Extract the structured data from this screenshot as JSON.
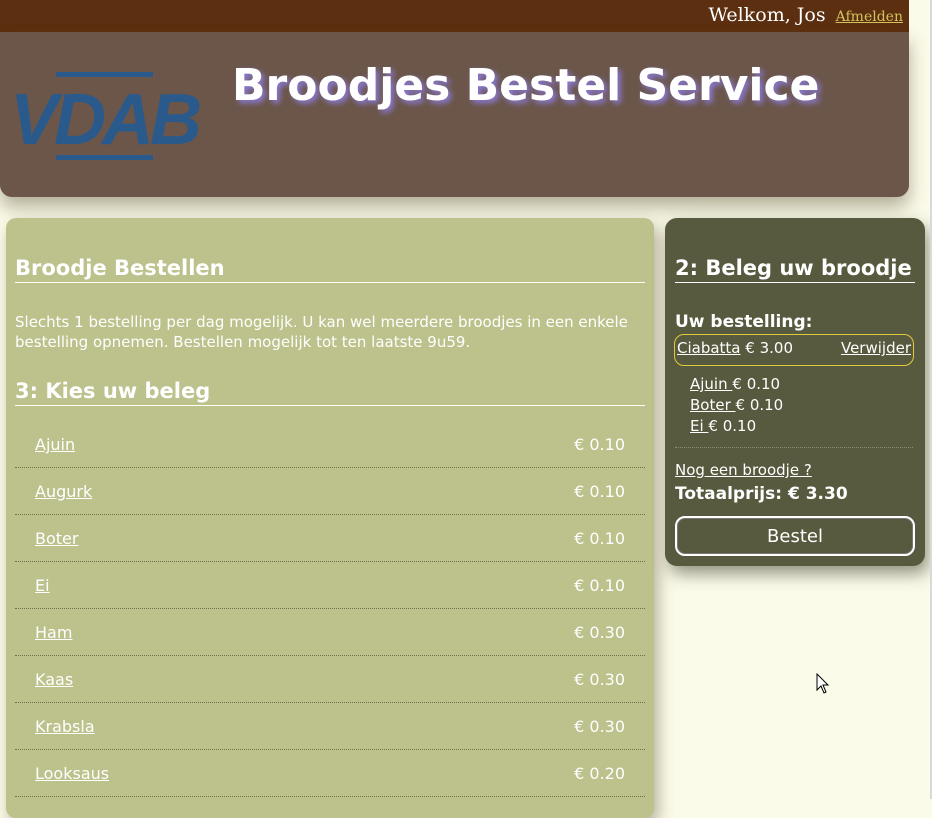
{
  "header": {
    "welcome_text": "Welkom, Jos",
    "logout_link": "Afmelden",
    "logo_text": "VDAB",
    "site_title": "Broodjes Bestel Service"
  },
  "main": {
    "title": "Broodje Bestellen",
    "intro": "Slechts 1 bestelling per dag mogelijk. U kan wel meerdere broodjes in een enkele bestelling opnemen. Bestellen mogelijk tot ten laatste 9u59.",
    "toppings_title": "3: Kies uw beleg",
    "toppings": [
      {
        "name": "Ajuin",
        "price": "€ 0.10"
      },
      {
        "name": "Augurk",
        "price": "€ 0.10"
      },
      {
        "name": "Boter",
        "price": "€ 0.10"
      },
      {
        "name": "Ei",
        "price": "€ 0.10"
      },
      {
        "name": "Ham",
        "price": "€ 0.30"
      },
      {
        "name": "Kaas",
        "price": "€ 0.30"
      },
      {
        "name": "Krabsla",
        "price": "€ 0.30"
      },
      {
        "name": "Looksaus",
        "price": "€ 0.20"
      }
    ]
  },
  "order": {
    "title": "2: Beleg uw broodje",
    "label": "Uw bestelling:",
    "item_name": "Ciabatta",
    "item_price": "€ 3.00",
    "remove_label": "Verwijder",
    "extras": [
      {
        "name": "Ajuin ",
        "price": "€ 0.10"
      },
      {
        "name": "Boter ",
        "price": "€ 0.10"
      },
      {
        "name": "Ei ",
        "price": "€ 0.10"
      }
    ],
    "another_link": "Nog een broodje ?",
    "total": "Totaalprijs: € 3.30",
    "submit_label": "Bestel"
  },
  "colors": {
    "topbar": "#5b2f0f",
    "header": "#6b5649",
    "main_panel": "#bdc18b",
    "order_panel": "#575a3e",
    "logo": "#2a5a8c",
    "accent": "#d3c35e"
  }
}
